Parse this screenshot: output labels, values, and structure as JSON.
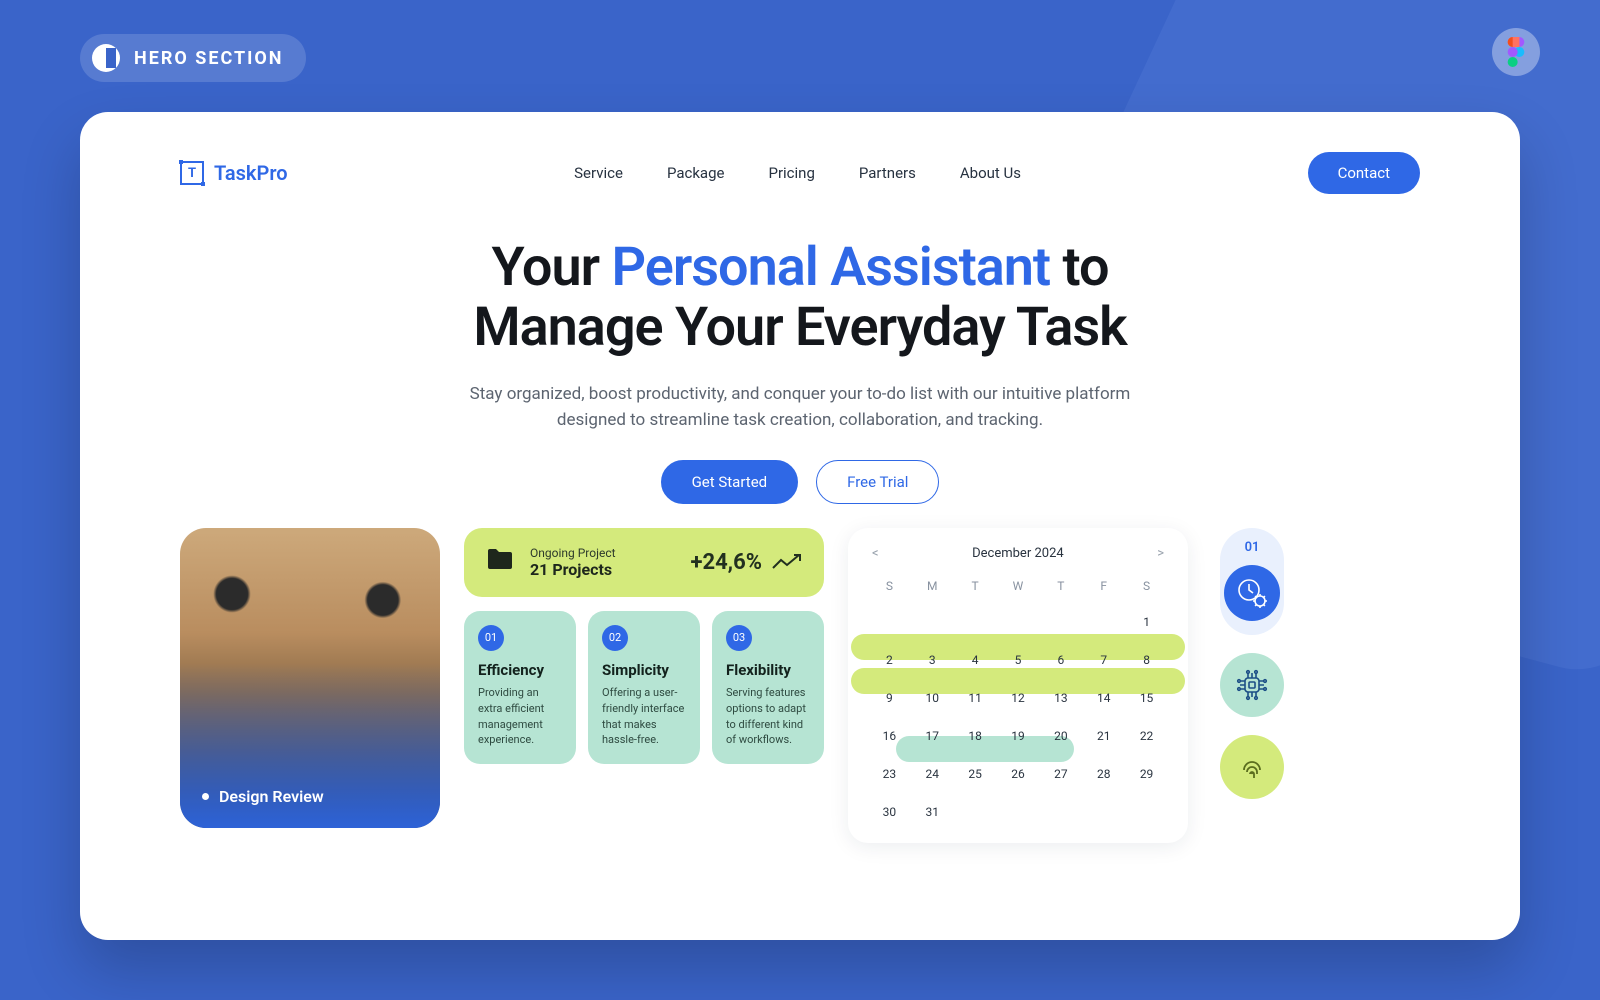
{
  "outer": {
    "badge_label": "HERO SECTION"
  },
  "nav": {
    "brand": "TaskPro",
    "links": [
      "Service",
      "Package",
      "Pricing",
      "Partners",
      "About Us"
    ],
    "contact": "Contact"
  },
  "hero": {
    "title_pre": "Your ",
    "title_accent": "Personal Assistant",
    "title_post": " to",
    "title_line2": "Manage Your Everyday Task",
    "subtitle": "Stay organized, boost productivity, and conquer your to-do list with our intuitive platform designed to streamline task creation, collaboration, and tracking.",
    "cta_primary": "Get Started",
    "cta_secondary": "Free Trial"
  },
  "photo": {
    "label": "Design Review"
  },
  "metric": {
    "small_label": "Ongoing Project",
    "value": "21 Projects",
    "delta": "+24,6%"
  },
  "features": [
    {
      "num": "01",
      "title": "Efficiency",
      "desc": "Providing an extra efficient management experience."
    },
    {
      "num": "02",
      "title": "Simplicity",
      "desc": "Offering a user-friendly interface that makes hassle-free."
    },
    {
      "num": "03",
      "title": "Flexibility",
      "desc": "Serving features options to adapt to different kind of workflows."
    }
  ],
  "calendar": {
    "month": "December 2024",
    "dows": [
      "S",
      "M",
      "T",
      "W",
      "T",
      "F",
      "S"
    ],
    "leading_blanks": 6,
    "days": [
      "1",
      "2",
      "3",
      "4",
      "5",
      "6",
      "7",
      "8",
      "9",
      "10",
      "11",
      "12",
      "13",
      "14",
      "15",
      "16",
      "17",
      "18",
      "19",
      "20",
      "21",
      "22",
      "23",
      "24",
      "25",
      "26",
      "27",
      "28",
      "29",
      "30",
      "31"
    ]
  },
  "iconcol": {
    "pill_num": "01"
  }
}
